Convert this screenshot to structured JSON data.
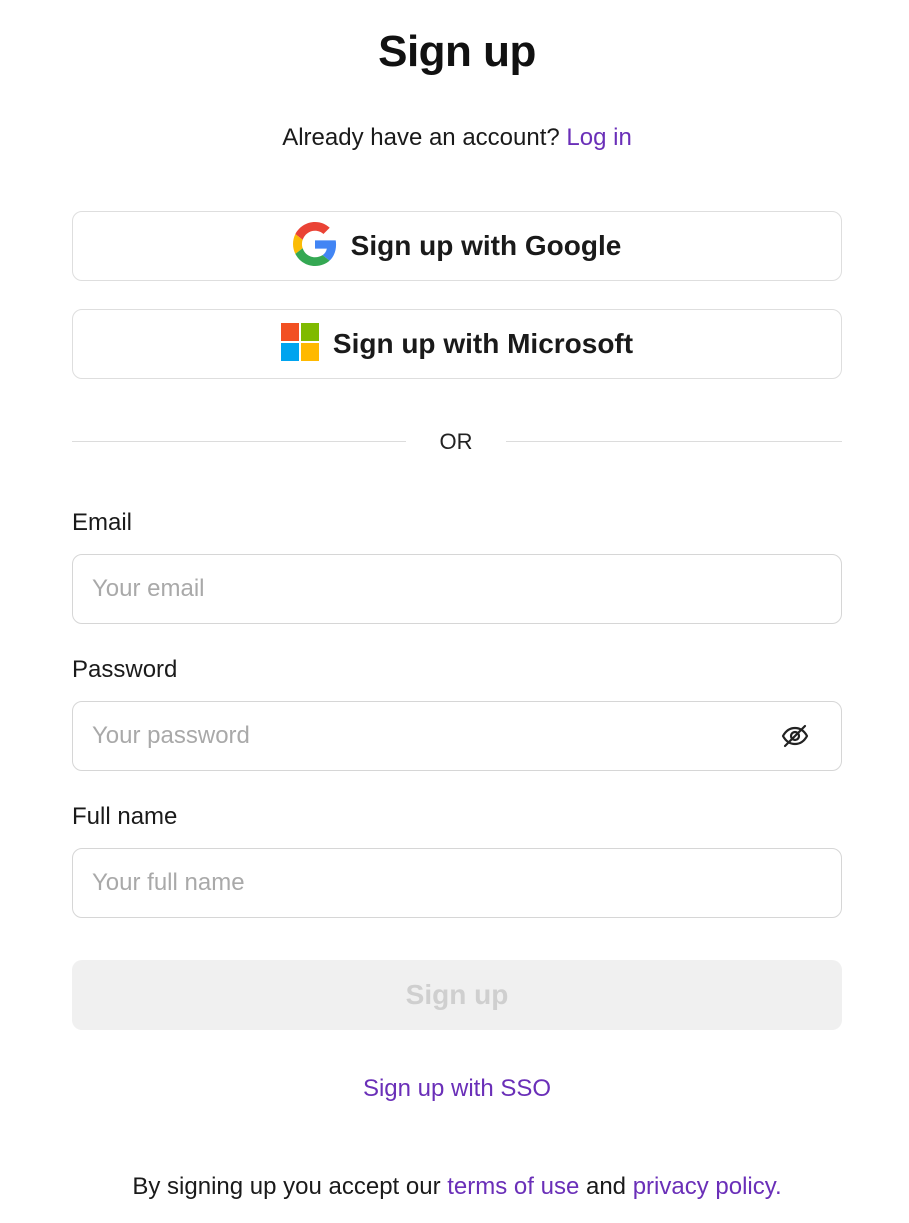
{
  "header": {
    "title": "Sign up",
    "already_text": "Already have an account?",
    "login_link": "Log in"
  },
  "oauth": {
    "google_label": "Sign up with Google",
    "microsoft_label": "Sign up with Microsoft"
  },
  "divider": {
    "text": "OR"
  },
  "form": {
    "email": {
      "label": "Email",
      "placeholder": "Your email",
      "value": ""
    },
    "password": {
      "label": "Password",
      "placeholder": "Your password",
      "value": "",
      "toggle_icon": "eye-off-icon"
    },
    "full_name": {
      "label": "Full name",
      "placeholder": "Your full name",
      "value": ""
    },
    "submit_label": "Sign up",
    "submit_enabled": false
  },
  "sso_link": "Sign up with SSO",
  "footer": {
    "prefix": "By signing up you accept our",
    "terms_link": "terms of use",
    "middle": "and",
    "privacy_link": "privacy policy."
  },
  "colors": {
    "link": "#6a2fb8",
    "border": "#dedede",
    "disabled_bg": "#f0f0f0",
    "disabled_text": "#cfcfcf",
    "google_blue": "#4285F4",
    "google_red": "#EA4335",
    "google_yellow": "#FBBC05",
    "google_green": "#34A853",
    "ms_red": "#F25022",
    "ms_green": "#7FBA00",
    "ms_blue": "#00A4EF",
    "ms_yellow": "#FFB900"
  }
}
